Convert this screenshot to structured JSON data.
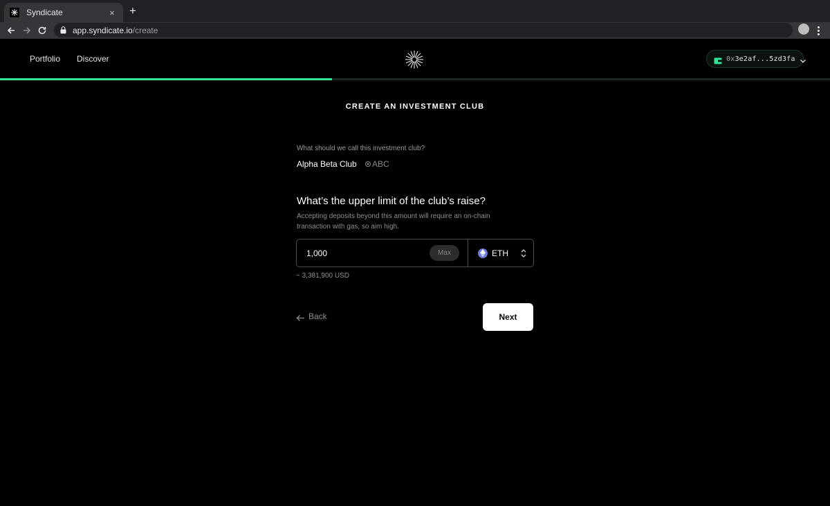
{
  "browser": {
    "tab_title": "Syndicate",
    "close_glyph": "×",
    "new_tab_glyph": "+",
    "url_host": "app.syndicate.io",
    "url_path": "/create"
  },
  "header": {
    "nav": [
      {
        "label": "Portfolio"
      },
      {
        "label": "Discover"
      }
    ],
    "wallet": {
      "address_prefix": "0x",
      "address_rest": "3e2af...5zd3fa"
    }
  },
  "progress": {
    "fraction": 0.4,
    "color": "#30e696"
  },
  "form": {
    "title": "CREATE AN INVESTMENT CLUB",
    "name_question": "What should we call this investment club?",
    "club_name": "Alpha Beta Club",
    "club_symbol": "ABC",
    "limit_question": "What’s the upper limit of the club’s raise?",
    "limit_description": "Accepting deposits beyond this amount will require an on-chain transaction with gas, so aim high.",
    "amount_value": "1,000",
    "max_label": "Max",
    "token": "ETH",
    "usd_estimate": "~ 3,381,900 USD",
    "back_label": "Back",
    "next_label": "Next"
  }
}
